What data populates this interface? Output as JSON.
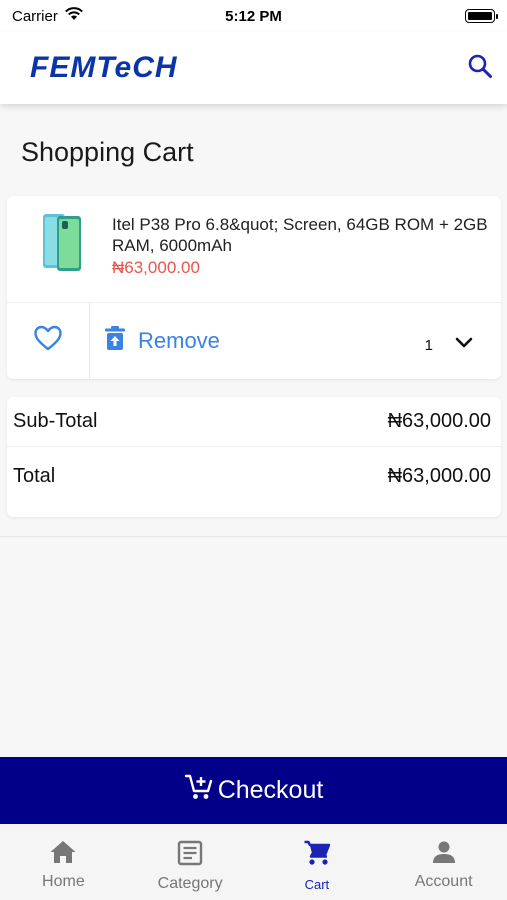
{
  "status_bar": {
    "carrier": "Carrier",
    "time": "5:12 PM"
  },
  "header": {
    "logo_text": "FEMTeCH",
    "brand_color": "#0a34a8"
  },
  "page": {
    "title": "Shopping Cart"
  },
  "cart_items": [
    {
      "name": "Itel P38 Pro 6.8&quot; Screen, 64GB ROM + 2GB RAM, 6000mAh",
      "price": "₦63,000.00",
      "quantity": "1",
      "remove_label": "Remove"
    }
  ],
  "totals": {
    "subtotal_label": "Sub-Total",
    "subtotal_value": "₦63,000.00",
    "total_label": "Total",
    "total_value": "₦63,000.00"
  },
  "checkout": {
    "label": "Checkout",
    "color": "#020089"
  },
  "bottom_nav": {
    "items": [
      {
        "label": "Home",
        "icon": "home-icon"
      },
      {
        "label": "Category",
        "icon": "category-icon"
      },
      {
        "label": "Cart",
        "icon": "cart-icon",
        "active": true
      },
      {
        "label": "Account",
        "icon": "account-icon"
      }
    ],
    "active_color": "#1c23b3"
  }
}
